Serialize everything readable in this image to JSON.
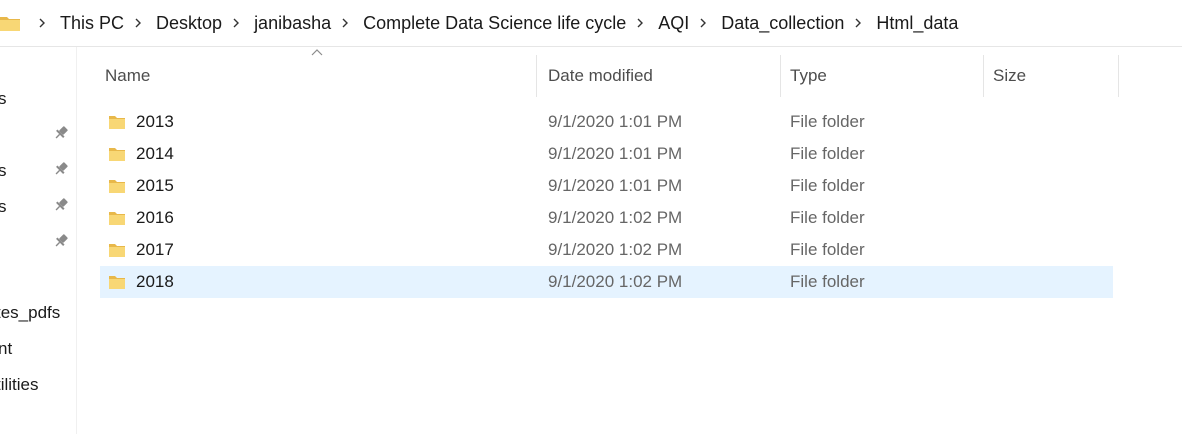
{
  "breadcrumb": [
    "This PC",
    "Desktop",
    "janibasha",
    "Complete Data Science life cycle",
    "AQI",
    "Data_collection",
    "Html_data"
  ],
  "nav": {
    "items": [
      {
        "label": "s",
        "pinned": false
      },
      {
        "label": "",
        "pinned": true
      },
      {
        "label": "s",
        "pinned": true
      },
      {
        "label": "s",
        "pinned": true
      },
      {
        "label": "",
        "pinned": true
      },
      {
        "label": "tes_pdfs",
        "pinned": false
      },
      {
        "label": "nt",
        "pinned": false
      },
      {
        "label": "tilities",
        "pinned": false
      }
    ]
  },
  "columns": {
    "name": "Name",
    "date": "Date modified",
    "type": "Type",
    "size": "Size"
  },
  "files": [
    {
      "name": "2013",
      "date": "9/1/2020 1:01 PM",
      "type": "File folder",
      "size": ""
    },
    {
      "name": "2014",
      "date": "9/1/2020 1:01 PM",
      "type": "File folder",
      "size": ""
    },
    {
      "name": "2015",
      "date": "9/1/2020 1:01 PM",
      "type": "File folder",
      "size": ""
    },
    {
      "name": "2016",
      "date": "9/1/2020 1:02 PM",
      "type": "File folder",
      "size": ""
    },
    {
      "name": "2017",
      "date": "9/1/2020 1:02 PM",
      "type": "File folder",
      "size": ""
    },
    {
      "name": "2018",
      "date": "9/1/2020 1:02 PM",
      "type": "File folder",
      "size": "",
      "selected": true
    }
  ],
  "colors": {
    "folder": "#f8d775",
    "folder_dark": "#e8b84a",
    "selection": "#e5f3ff",
    "pin": "#8a8a8a"
  },
  "icons": {
    "folder": "folder-icon",
    "separator": "chevron-right-icon",
    "pin": "pin-icon",
    "sort": "sort-up-icon"
  }
}
